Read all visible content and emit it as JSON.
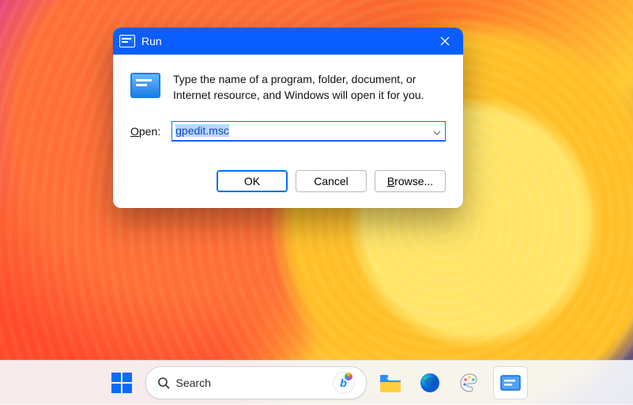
{
  "run_dialog": {
    "title": "Run",
    "description": "Type the name of a program, folder, document, or Internet resource, and Windows will open it for you.",
    "open_label_text": "Open:",
    "open_label_underline_char": "O",
    "open_label_rest": "pen:",
    "input_value": "gpedit.msc",
    "buttons": {
      "ok": "OK",
      "cancel": "Cancel",
      "browse_underline": "B",
      "browse_rest": "rowse..."
    }
  },
  "taskbar": {
    "search_placeholder": "Search"
  }
}
